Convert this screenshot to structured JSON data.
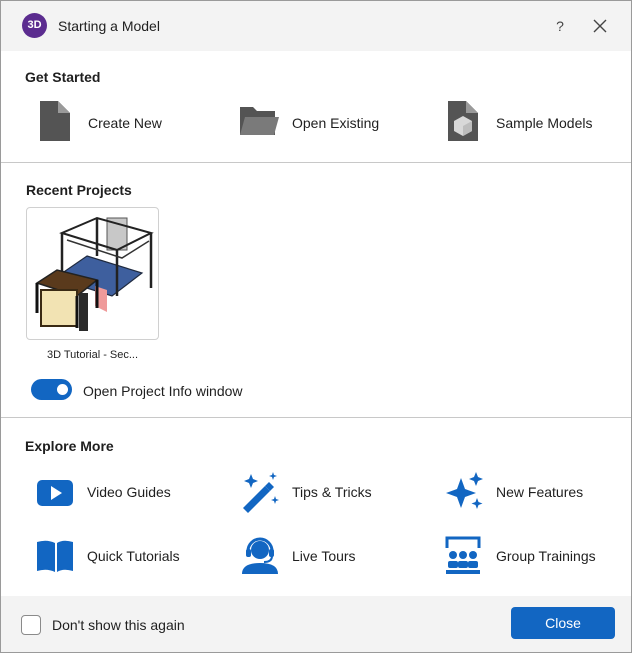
{
  "window": {
    "logo_text": "3D",
    "title": "Starting a Model",
    "help_label": "?"
  },
  "get_started": {
    "heading": "Get Started",
    "create_new": "Create New",
    "open_existing": "Open Existing",
    "sample_models": "Sample Models"
  },
  "recent_projects": {
    "heading": "Recent Projects",
    "items": [
      {
        "name": "3D Tutorial - Sec..."
      }
    ],
    "toggle_label": "Open Project Info window",
    "toggle_on": true
  },
  "explore_more": {
    "heading": "Explore More",
    "video_guides": "Video Guides",
    "tips_tricks": "Tips & Tricks",
    "new_features": "New Features",
    "quick_tutorials": "Quick Tutorials",
    "live_tours": "Live Tours",
    "group_trainings": "Group Trainings"
  },
  "footer": {
    "dont_show_label": "Don't show this again",
    "dont_show_checked": false,
    "close_label": "Close"
  },
  "colors": {
    "accent": "#1266c2",
    "logo": "#5b2c8f",
    "icon_gray": "#545454"
  }
}
